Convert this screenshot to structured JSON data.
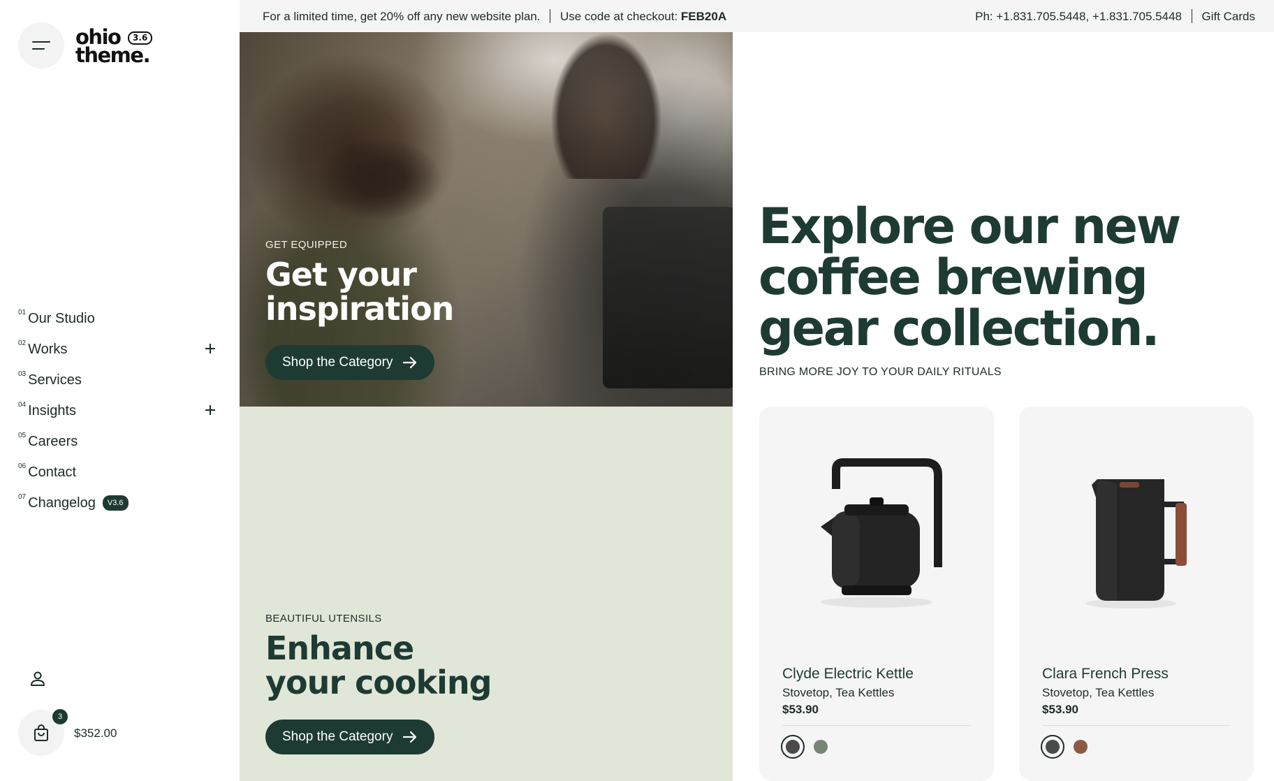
{
  "brand": {
    "name_line1": "ohio",
    "name_line2": "theme.",
    "version_badge": "3.6"
  },
  "topbar": {
    "promo_text": "For a limited time, get 20% off any new website plan.",
    "code_label": "Use code at checkout:",
    "code": "FEB20A",
    "phone": "Ph: +1.831.705.5448, +1.831.705.5448",
    "gift_cards": "Gift Cards"
  },
  "nav": {
    "items": [
      {
        "num": "01",
        "label": "Our Studio"
      },
      {
        "num": "02",
        "label": "Works"
      },
      {
        "num": "03",
        "label": "Services"
      },
      {
        "num": "04",
        "label": "Insights"
      },
      {
        "num": "05",
        "label": "Careers"
      },
      {
        "num": "06",
        "label": "Contact"
      },
      {
        "num": "07",
        "label": "Changelog",
        "badge": "V3.6"
      }
    ]
  },
  "cart": {
    "count": "3",
    "total": "$352.00"
  },
  "hero": {
    "eyebrow": "GET EQUIPPED",
    "headline_line1": "Get your",
    "headline_line2": "inspiration",
    "cta": "Shop the Category"
  },
  "utensils": {
    "eyebrow": "BEAUTIFUL UTENSILS",
    "headline_line1": "Enhance",
    "headline_line2": "your cooking",
    "cta": "Shop the Category"
  },
  "collection": {
    "headline_line1": "Explore our new",
    "headline_line2": "coffee brewing",
    "headline_line3": "gear collection.",
    "tagline": "BRING MORE JOY TO YOUR DAILY RITUALS"
  },
  "products": [
    {
      "name": "Clyde Electric Kettle",
      "categories": "Stovetop, Tea Kettles",
      "price": "$53.90",
      "swatches": [
        "#4a4a4a",
        "#778574"
      ]
    },
    {
      "name": "Clara French Press",
      "categories": "Stovetop, Tea Kettles",
      "price": "$53.90",
      "swatches": [
        "#4a4a4a",
        "#8b5a45"
      ]
    }
  ],
  "colors": {
    "brand_dark": "#1e3b33",
    "utensils_bg": "#e1e7d8",
    "topbar_bg": "#f5f5f6"
  },
  "icons": {
    "menu": "hamburger-icon",
    "user": "user-icon",
    "cart": "shopping-bag-icon",
    "cta": "arrow-right-icon",
    "expand": "plus-icon"
  }
}
